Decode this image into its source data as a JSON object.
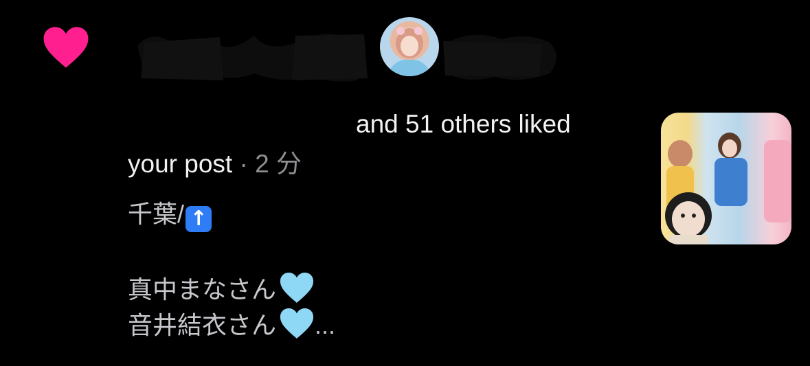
{
  "notification": {
    "heart_icon": "heart-icon",
    "accent_color": "#ff1f8e",
    "username": "",
    "summary_line1": "and 51 others liked",
    "summary_line2": "your post",
    "separator": " · ",
    "time": "2 分",
    "caption": {
      "line1": "千葉/",
      "line1_emoji": "↑",
      "line3": "真中まなさん",
      "line4": "音井結衣さん",
      "ellipsis": "..."
    },
    "heart_emoji_color": "#8fd8f5"
  }
}
